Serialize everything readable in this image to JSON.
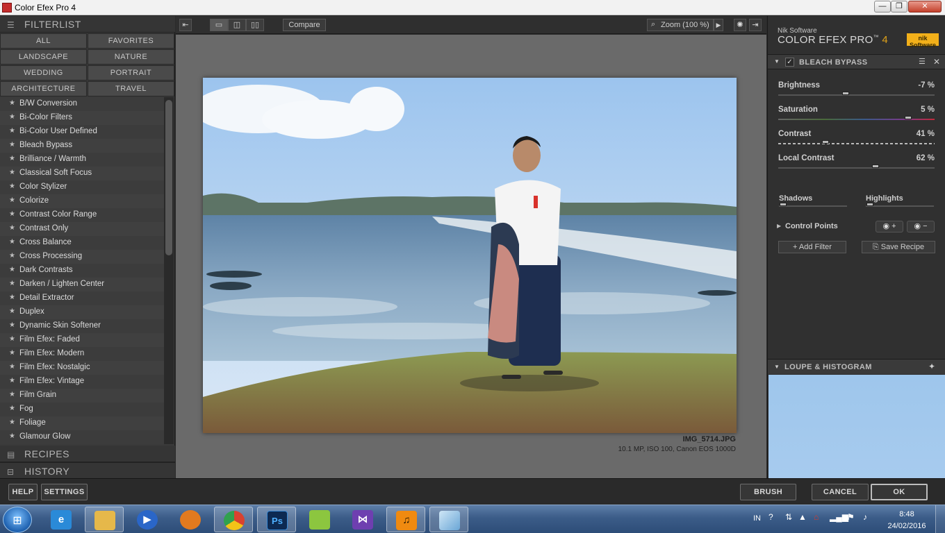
{
  "window": {
    "title": "Color Efex Pro 4",
    "min_glyph": "—",
    "max_glyph": "❐",
    "close_glyph": "✕"
  },
  "left": {
    "filterlist_title": "FILTERLIST",
    "categories": [
      "ALL",
      "FAVORITES",
      "LANDSCAPE",
      "NATURE",
      "WEDDING",
      "PORTRAIT",
      "ARCHITECTURE",
      "TRAVEL"
    ],
    "filters": [
      "B/W Conversion",
      "Bi-Color Filters",
      "Bi-Color User Defined",
      "Bleach Bypass",
      "Brilliance / Warmth",
      "Classical Soft Focus",
      "Color Stylizer",
      "Colorize",
      "Contrast Color Range",
      "Contrast Only",
      "Cross Balance",
      "Cross Processing",
      "Dark Contrasts",
      "Darken / Lighten Center",
      "Detail Extractor",
      "Duplex",
      "Dynamic Skin Softener",
      "Film Efex: Faded",
      "Film Efex: Modern",
      "Film Efex: Nostalgic",
      "Film Efex: Vintage",
      "Film Grain",
      "Fog",
      "Foliage",
      "Glamour Glow"
    ],
    "recipes_title": "RECIPES",
    "history_title": "HISTORY"
  },
  "toolbar": {
    "compare_label": "Compare",
    "zoom_label": "Zoom (100 %)"
  },
  "canvas": {
    "file_name": "IMG_5714.JPG",
    "file_meta": "10.1 MP, ISO 100, Canon EOS 1000D"
  },
  "right": {
    "brand_sub": "Nik Software",
    "brand_name": "COLOR EFEX PRO",
    "brand_tm": "™",
    "brand_version": "4",
    "logo_text": "nik Software",
    "filter_name": "BLEACH BYPASS",
    "params": [
      {
        "name": "Brightness",
        "value": "-7 %",
        "level": 0.43
      },
      {
        "name": "Saturation",
        "value": "5 %",
        "level": 0.83
      },
      {
        "name": "Contrast",
        "value": "41 %",
        "level": 0.3
      },
      {
        "name": "Local Contrast",
        "value": "62 %",
        "level": 0.62
      }
    ],
    "shadows_label": "Shadows",
    "highlights_label": "Highlights",
    "control_points_label": "Control Points",
    "add_filter_label": "Add Filter",
    "save_recipe_label": "Save Recipe",
    "loupe_title": "LOUPE & HISTOGRAM"
  },
  "actions": {
    "help_label": "HELP",
    "settings_label": "SETTINGS",
    "brush_label": "BRUSH",
    "cancel_label": "CANCEL",
    "ok_label": "OK"
  },
  "taskbar": {
    "lang": "IN",
    "time": "8:48",
    "date": "24/02/2016"
  },
  "colors": {
    "accent_version": "#e0a21a",
    "loupe_sky": "#9ec6ec",
    "taskbar": "#3b5c88"
  }
}
